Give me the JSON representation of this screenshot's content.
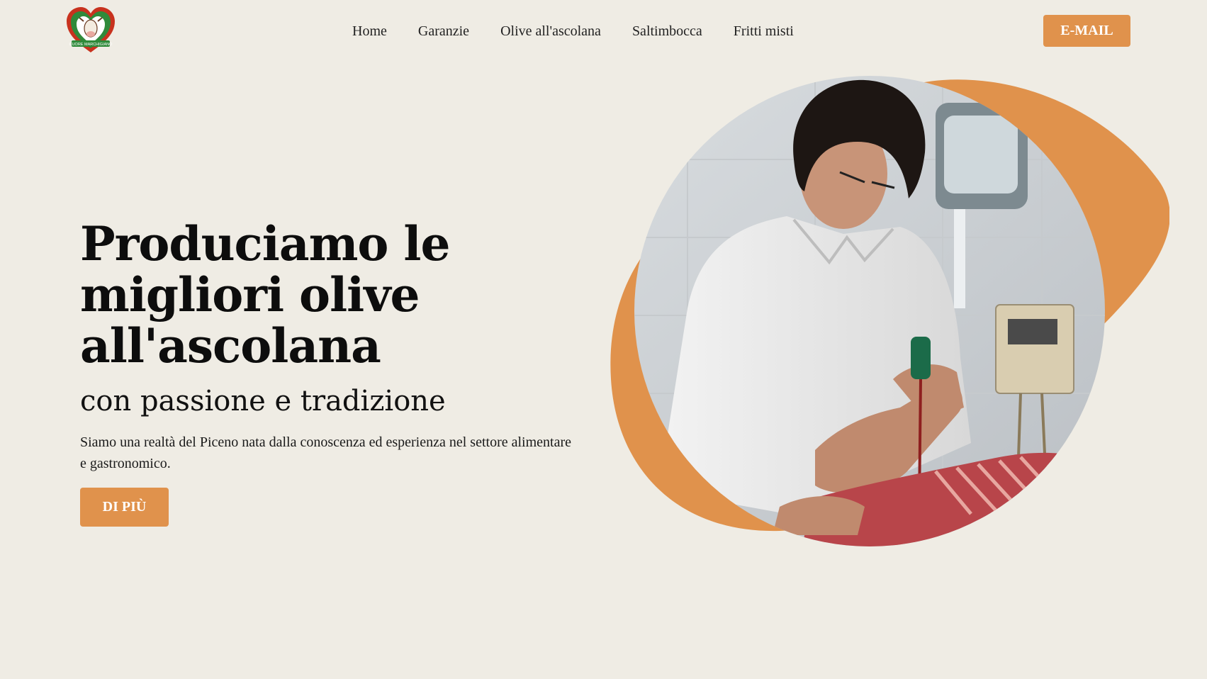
{
  "brand": {
    "logo_text": "CUORE MARCHIGIANO",
    "accent_color": "#e0924c",
    "background_color": "#efece4"
  },
  "nav": {
    "items": [
      {
        "label": "Home"
      },
      {
        "label": "Garanzie"
      },
      {
        "label": "Olive all'ascolana"
      },
      {
        "label": "Saltimbocca"
      },
      {
        "label": "Fritti misti"
      }
    ],
    "email_label": "E-MAIL"
  },
  "hero": {
    "title": "Produciamo le migliori olive all'ascolana",
    "subtitle": "con passione e tradizione",
    "description": "Siamo una realtà del Piceno nata dalla conoscenza ed esperienza nel settore alimentare e gastronomico.",
    "cta_label": "DI PIÙ",
    "image_icon": "butcher-photo"
  }
}
